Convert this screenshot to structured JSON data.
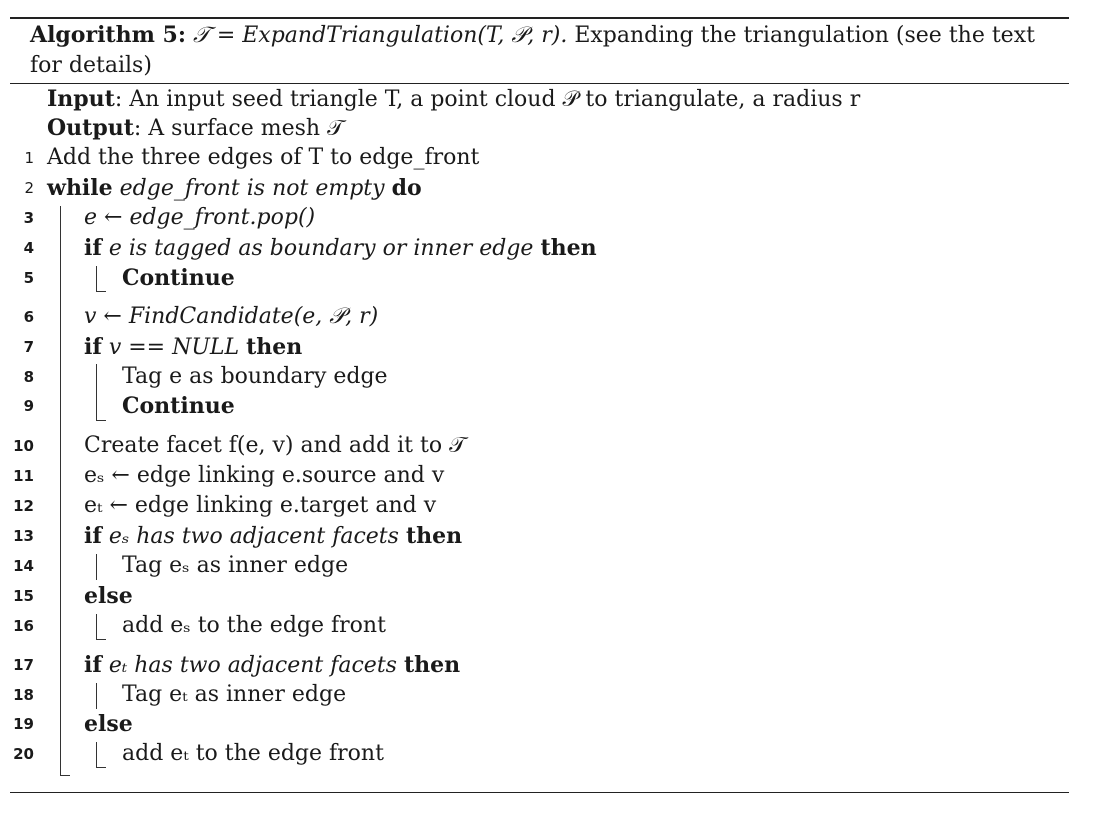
{
  "caption": {
    "label": "Algorithm 5:",
    "math": "𝒯 = ExpandTriangulation(T, 𝒫, r).",
    "text": "Expanding the triangulation (see the text",
    "text2": "for details)"
  },
  "input": {
    "key": "Input",
    "text": ": An input seed triangle T, a point cloud 𝒫 to triangulate, a radius r"
  },
  "output": {
    "key": "Output",
    "text": ": A surface mesh 𝒯"
  },
  "lines": [
    {
      "n": "1",
      "text": "Add the three edges of T to edge_front"
    },
    {
      "n": "2",
      "kw1": "while",
      "cond": "edge_front is not empty",
      "kw2": "do"
    },
    {
      "n": "3",
      "text": "e ← edge_front.pop()"
    },
    {
      "n": "4",
      "kw1": "if",
      "cond": "e is tagged as boundary or inner edge",
      "kw2": "then"
    },
    {
      "n": "5",
      "kw1": "Continue"
    },
    {
      "n": "6",
      "text": "v ← FindCandidate(e, 𝒫, r)"
    },
    {
      "n": "7",
      "kw1": "if",
      "cond": "v == NULL",
      "kw2": "then"
    },
    {
      "n": "8",
      "text": "Tag e as boundary edge"
    },
    {
      "n": "9",
      "kw1": "Continue"
    },
    {
      "n": "10",
      "text": "Create facet f(e, v) and add it to 𝒯"
    },
    {
      "n": "11",
      "text": "eₛ ← edge linking e.source and v"
    },
    {
      "n": "12",
      "text": "eₜ ← edge linking e.target and v"
    },
    {
      "n": "13",
      "kw1": "if",
      "cond": "eₛ has two adjacent facets",
      "kw2": "then"
    },
    {
      "n": "14",
      "text": "Tag eₛ as inner edge"
    },
    {
      "n": "15",
      "kw1": "else"
    },
    {
      "n": "16",
      "text": "add eₛ to the edge front"
    },
    {
      "n": "17",
      "kw1": "if",
      "cond": "eₜ has two adjacent facets",
      "kw2": "then"
    },
    {
      "n": "18",
      "text": "Tag eₜ as inner edge"
    },
    {
      "n": "19",
      "kw1": "else"
    },
    {
      "n": "20",
      "text": "add eₜ to the edge front"
    }
  ]
}
